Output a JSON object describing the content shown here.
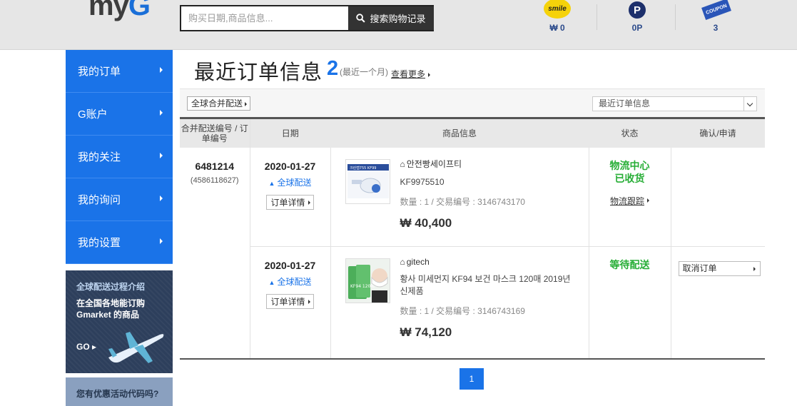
{
  "header": {
    "logo_prefix": "my",
    "logo_suffix": "G",
    "search": {
      "placeholder": "购买日期,商品信息...",
      "button_label": "搜索购物记录"
    },
    "smile": {
      "icon_text": "smile",
      "value": "₩ 0"
    },
    "point": {
      "icon_text": "P",
      "value": "0P"
    },
    "coupon": {
      "icon_text": "COUPON",
      "value": "3"
    }
  },
  "sidebar": {
    "items": [
      {
        "label": "我的订单"
      },
      {
        "label": "G账户"
      },
      {
        "label": "我的关注"
      },
      {
        "label": "我的询问"
      },
      {
        "label": "我的设置"
      }
    ],
    "promo": {
      "title": "全球配送过程介绍",
      "text": "在全国各地能订购Gmarket 的商品",
      "go": "GO"
    },
    "promo2": {
      "text": "您有优惠活动代码吗?"
    }
  },
  "main": {
    "title": "最近订单信息",
    "count": "2",
    "subtitle": "(最近一个月)",
    "more_link": "查看更多",
    "combine_button": "全球合并配送",
    "select_value": "最近订单信息",
    "columns": [
      "合并配送编号 / 订单编号",
      "日期",
      "商品信息",
      "状态",
      "确认/申请"
    ],
    "order": {
      "number": "6481214",
      "sub_number": "(4586118627)"
    },
    "rows": [
      {
        "date": "2020-01-27",
        "shipping": "全球配送",
        "detail_button": "订单详情",
        "seller": "안전빵세이프티",
        "product": "KF9975510",
        "qty": "数量 : 1 / 交易编号 : 3146743170",
        "price": "₩ 40,400",
        "status_line1": "物流中心",
        "status_line2": "已收货",
        "track_link": "物流跟踪",
        "thumb_label": "크린랩755 KF99"
      },
      {
        "date": "2020-01-27",
        "shipping": "全球配送",
        "detail_button": "订单详情",
        "seller": "gitech",
        "product": "황사 미세먼지 KF94 보건 마스크 120매 2019년 신제품",
        "qty": "数量 : 1 / 交易编号 : 3146743169",
        "price": "₩ 74,120",
        "status_line1": "等待配送",
        "cancel_button": "取消订单",
        "thumb_label": "KF94 120매"
      }
    ],
    "page": "1"
  },
  "colors": {
    "accent": "#1a73e8",
    "status_green": "#27ae36",
    "header_bg": "#e6e6e6"
  }
}
